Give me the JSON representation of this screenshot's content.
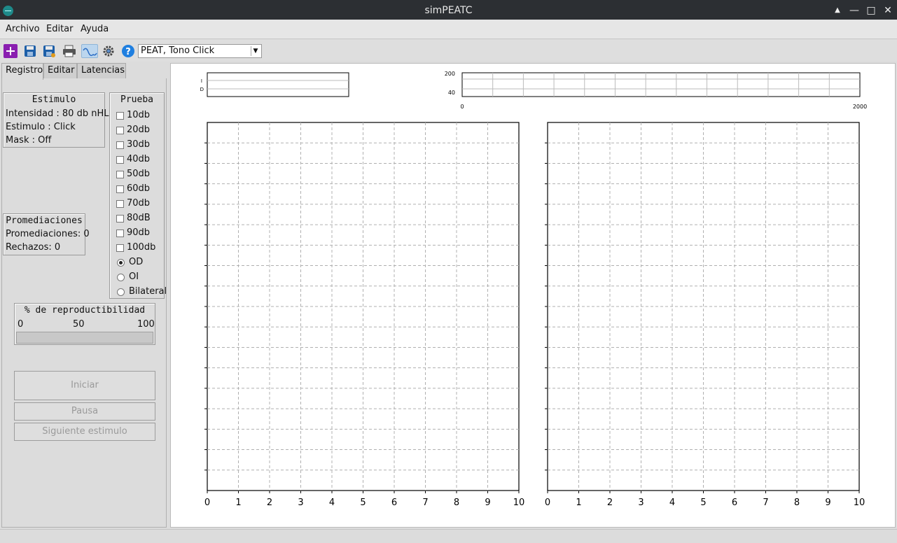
{
  "window": {
    "title": "simPEATC",
    "controls": {
      "minimize_left": "▲",
      "minimize": "—",
      "maximize": "□",
      "close": "✕"
    }
  },
  "menu": [
    "Archivo",
    "Editar",
    "Ayuda"
  ],
  "toolbar": {
    "icons": [
      "new-icon",
      "save-icon",
      "save-as-icon",
      "print-icon",
      "waveform-icon",
      "settings-gear-icon",
      "help-icon"
    ],
    "combo_value": "PEAT, Tono Click"
  },
  "tabs": [
    "Registro",
    "Editar",
    "Latencias"
  ],
  "estimulo": {
    "title": "Estimulo",
    "intensidad": "Intensidad : 80 db nHL",
    "estimulo": "Estimulo : Click",
    "mask": "Mask : Off"
  },
  "promediaciones": {
    "title": "Promediaciones",
    "count": "Promediaciones: 0",
    "rechazos": "Rechazos: 0"
  },
  "prueba": {
    "title": "Prueba",
    "checks": [
      "10db",
      "20db",
      "30db",
      "40db",
      "50db",
      "60db",
      "70db",
      "80dB",
      "90db",
      "100db"
    ],
    "radios": [
      "OD",
      "OI",
      "Bilateral"
    ],
    "selected_radio": "OD"
  },
  "reproducibilidad": {
    "title": "% de reproductibilidad",
    "scale": [
      "0",
      "50",
      "100"
    ],
    "value": 0
  },
  "buttons": {
    "iniciar": "Iniciar",
    "pausa": "Pausa",
    "siguiente": "Siguiente estimulo"
  },
  "plots": {
    "small_left": {
      "ylabels": [
        "I",
        "D"
      ]
    },
    "small_right": {
      "yticks": [
        "200",
        "40"
      ],
      "xticks": [
        "0",
        "2000"
      ]
    },
    "main_xticks": [
      "0",
      "1",
      "2",
      "3",
      "4",
      "5",
      "6",
      "7",
      "8",
      "9",
      "10"
    ]
  }
}
